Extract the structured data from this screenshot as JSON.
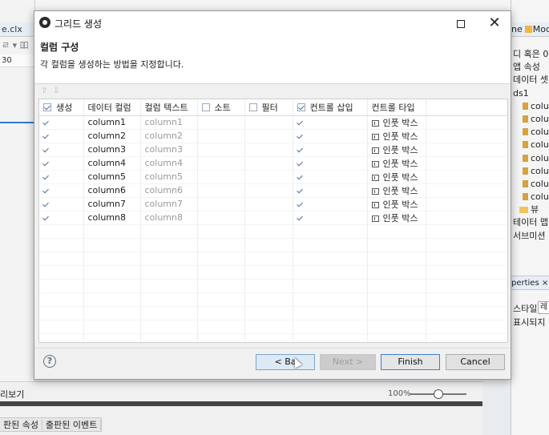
{
  "background": {
    "left_tab": "e.clx",
    "left_ruler": "30",
    "bottom_left_tab": "리보기",
    "zoom": "100%",
    "bottom_tabs": [
      "판된 속성",
      "출판된 이벤트"
    ],
    "right_tab": "Mod",
    "right_tab_prefix": "ne",
    "tree": [
      "디 혹은 0",
      "앱 속성",
      "데이터 셋",
      "ds1",
      "colu",
      "colu",
      "colu",
      "colu",
      "colu",
      "colu",
      "colu",
      "colu",
      "뷰",
      "테이터 맵",
      "서브미션"
    ],
    "properties_tab": "perties",
    "prop_labels": [
      "스타일",
      "표시되지"
    ],
    "prop_value": "레"
  },
  "dialog": {
    "title": "그리드 생성",
    "page_title": "컬럼 구성",
    "description": "각 컬럼을 생성하는 방법을 지정합니다.",
    "headers": {
      "create": "생성",
      "data_column": "데이터 컬럼",
      "column_text": "컬럼 텍스트",
      "sort": "소트",
      "filter": "필터",
      "insert_control": "컨트롤 삽입",
      "control_type": "컨트롤 타입"
    },
    "rows": [
      {
        "data": "column1",
        "text": "column1",
        "type": "인풋 박스"
      },
      {
        "data": "column2",
        "text": "column2",
        "type": "인풋 박스"
      },
      {
        "data": "column3",
        "text": "column3",
        "type": "인풋 박스"
      },
      {
        "data": "column4",
        "text": "column4",
        "type": "인풋 박스"
      },
      {
        "data": "column5",
        "text": "column5",
        "type": "인풋 박스"
      },
      {
        "data": "column6",
        "text": "column6",
        "type": "인풋 박스"
      },
      {
        "data": "column7",
        "text": "column7",
        "type": "인풋 박스"
      },
      {
        "data": "column8",
        "text": "column8",
        "type": "인풋 박스"
      }
    ],
    "buttons": {
      "back": "< Ba",
      "next": "Next >",
      "finish": "Finish",
      "cancel": "Cancel",
      "help": "?"
    }
  }
}
